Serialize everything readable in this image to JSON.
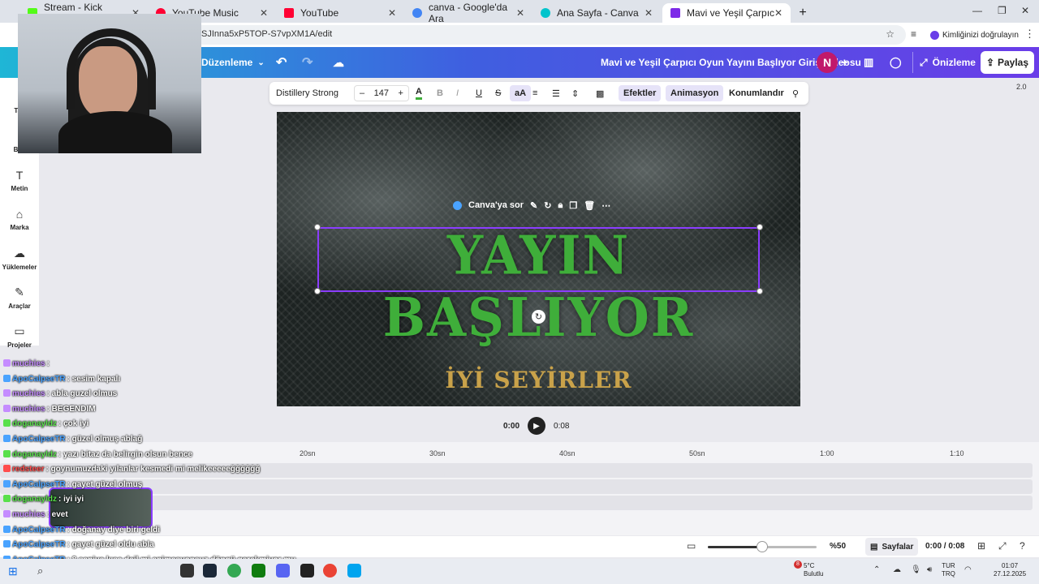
{
  "browser": {
    "tabs": [
      {
        "label": "Stream - Kick Dashboard",
        "color": "#53fc18"
      },
      {
        "label": "YouTube Music",
        "color": "#ff0033"
      },
      {
        "label": "YouTube",
        "color": "#ff0033"
      },
      {
        "label": "canva - Google'da Ara",
        "color": "#4285f4"
      },
      {
        "label": "Ana Sayfa - Canva",
        "color": "#00c4cc"
      },
      {
        "label": "Mavi ve Yeşil Çarpıcı Oyun Yayı",
        "color": "#7d2ae8"
      }
    ],
    "new_tab": "+",
    "url": "SJInna5xP5TOP-S7vpXM1A/edit",
    "verify_label": "Kimliğinizi doğrulayın"
  },
  "header": {
    "menu": "Düzenleme",
    "doc_title": "Mavi ve Yeşil Çarpıcı Oyun Yayını Başlıyor Giriş Videosu",
    "avatar": "N",
    "preview": "Önizleme",
    "share": "Paylaş"
  },
  "sidebar": {
    "items": [
      {
        "label": "Tas"
      },
      {
        "label": "Bile"
      },
      {
        "label": "Metin"
      },
      {
        "label": "Marka"
      },
      {
        "label": "Yüklemeler"
      },
      {
        "label": "Araçlar"
      },
      {
        "label": "Projeler"
      }
    ]
  },
  "toolbar": {
    "font": "Distillery Strong",
    "font_size": "147",
    "minus": "–",
    "plus": "+",
    "bold": "B",
    "italic": "I",
    "underline": "U",
    "strike": "S",
    "case": "aA",
    "effects": "Efektler",
    "animation": "Animasyon",
    "position": "Konumlandır"
  },
  "zoom_badge": "2.0",
  "canvas": {
    "title": "YAYIN BAŞLIYOR",
    "subtitle": "İYİ SEYİRLER",
    "ask_canva": "Canva'ya sor"
  },
  "playback": {
    "current": "0:00",
    "total": "0:08"
  },
  "timeline": {
    "ticks": [
      "20sn",
      "30sn",
      "40sn",
      "50sn",
      "1:00",
      "1:10"
    ]
  },
  "bottombar": {
    "zoom": "%50",
    "zoom_level": 0.5,
    "pages": "Sayfalar",
    "time": "0:00 / 0:08"
  },
  "chat": {
    "messages": [
      {
        "user": "muchies",
        "text": ":",
        "color": "#c58cff"
      },
      {
        "user": "ApoCalpseTR",
        "text": ": sesim kapalı",
        "color": "#4aa3ff"
      },
      {
        "user": "muchies",
        "text": ": abla guzel olmus",
        "color": "#c58cff"
      },
      {
        "user": "muchies",
        "text": ": BEGENDIM",
        "color": "#c58cff"
      },
      {
        "user": "doganayldz",
        "text": ": çok iyi",
        "color": "#59e04b"
      },
      {
        "user": "ApoCalpseTR",
        "text": ": güzel olmuş ablağ",
        "color": "#4aa3ff"
      },
      {
        "user": "doganayldz",
        "text": ": yazı bitaz da belirgin olsun bence",
        "color": "#59e04b"
      },
      {
        "user": "redsteer",
        "text": ": goynumuzdaki yılanlar kesmedi mi melikeeeeeğğğğğğ",
        "color": "#ff4d4d"
      },
      {
        "user": "ApoCalpseTR",
        "text": ": gayet güzel olmuş",
        "color": "#4aa3ff"
      },
      {
        "user": "doganayldz",
        "text": ": iyi iyi",
        "color": "#59e04b"
      },
      {
        "user": "muchies",
        "text": ": evet",
        "color": "#c58cff"
      },
      {
        "user": "ApoCalpseTR",
        "text": ": doğanay diye biri geldi",
        "color": "#4aa3ff"
      },
      {
        "user": "ApoCalpseTR",
        "text": ": gayet güzel oldu abla",
        "color": "#4aa3ff"
      },
      {
        "user": "ApoCalpseTR",
        "text": ": 8 saniye kısa deil mi animasyonsuz döngü gerekmiyor mu",
        "color": "#4aa3ff"
      },
      {
        "user": "doganayldz",
        "text": ": çok parlak yazı biraz kıs abla",
        "color": "#59e04b"
      }
    ]
  },
  "taskbar": {
    "weather_temp": "5°C",
    "weather_label": "Bulutlu",
    "lang1": "TUR",
    "lang2": "TRQ",
    "time": "01:07",
    "date": "27.12.2025",
    "notif_count": "8"
  },
  "colors": {
    "accent": "#8b3dff",
    "title_green": "#3fae3a",
    "subtitle_gold": "#c9a24a"
  }
}
